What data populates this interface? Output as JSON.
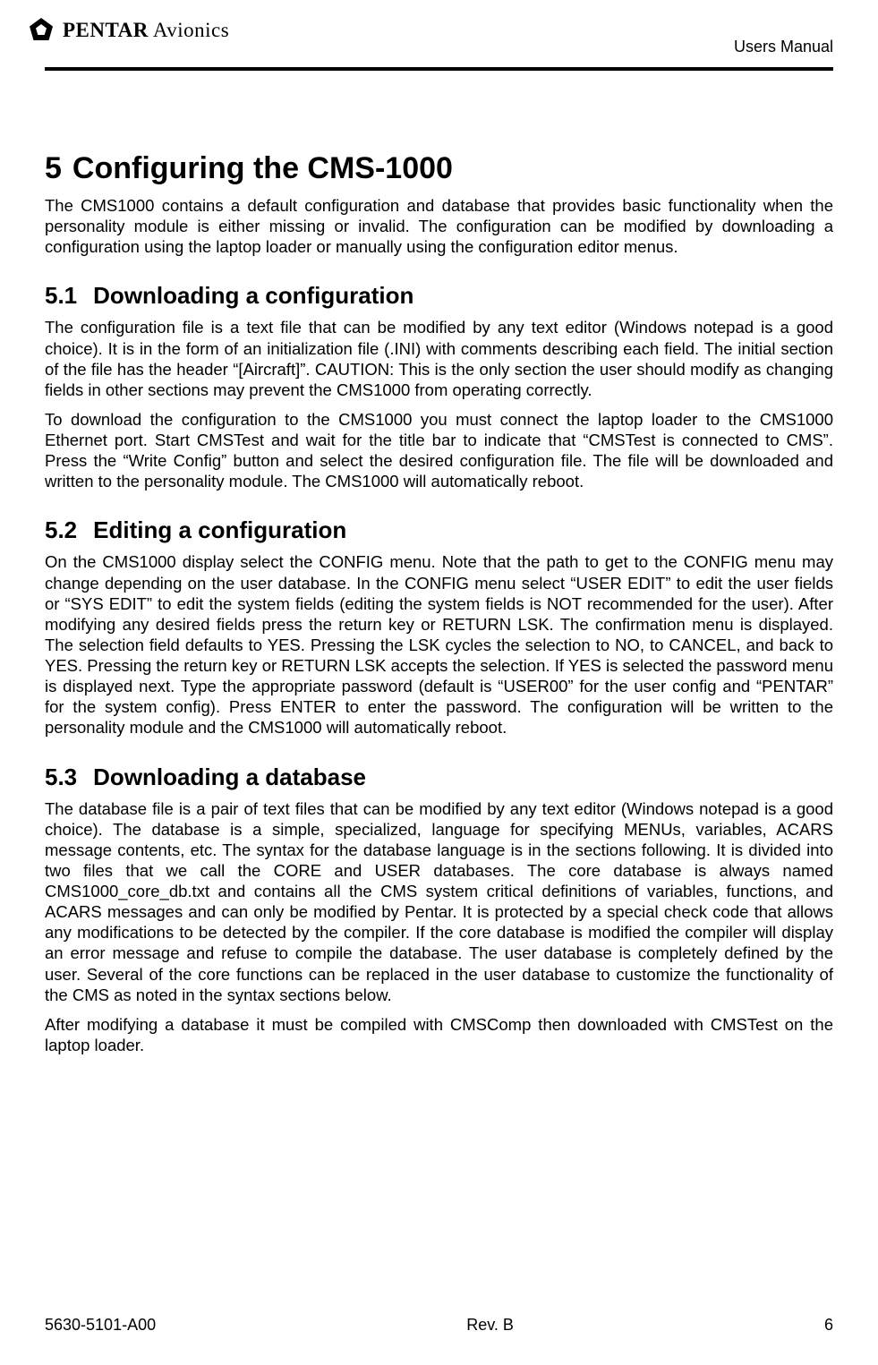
{
  "header": {
    "brand_bold": "PENTAR",
    "brand_light": " Avionics",
    "manual_label": "Users Manual"
  },
  "content": {
    "h1_num": "5",
    "h1_title": "Configuring the CMS-1000",
    "p_intro": "The CMS1000 contains a default configuration and database that provides basic functionality when the personality module is either missing or invalid.  The configuration can be modified by downloading a configuration using the laptop loader or manually using the configuration editor menus.",
    "s51_num": "5.1",
    "s51_title": "Downloading a configuration",
    "s51_p1": "The configuration file is a text file that can be modified by any text editor (Windows notepad is a good choice).  It is in the form of an initialization file (.INI) with comments describing each field.  The initial section of the file has the header “[Aircraft]”.  CAUTION: This is the only section the user should modify as changing fields in other sections may prevent the CMS1000 from operating correctly.",
    "s51_p2": "To download the configuration to the CMS1000 you must connect the laptop loader to the CMS1000 Ethernet port.  Start CMSTest and wait for the title bar to indicate that “CMSTest is connected to CMS”.  Press the “Write Config” button and select the desired configuration file.  The file will be downloaded and written to the personality module.  The CMS1000 will automatically reboot.",
    "s52_num": "5.2",
    "s52_title": "Editing a configuration",
    "s52_p1": "On the CMS1000 display select the CONFIG menu.  Note that the path to get to the CONFIG menu may change depending on the user database.  In the CONFIG menu select “USER EDIT” to edit the user fields or “SYS EDIT” to edit the system fields (editing the system fields is NOT recommended for the user).  After modifying any desired fields press the return key or RETURN LSK.  The confirmation menu is displayed.  The selection field defaults to YES.  Pressing the LSK cycles the selection to NO, to CANCEL, and back to YES.  Pressing the return key or RETURN LSK accepts the selection.  If YES is selected the password menu is displayed next.  Type the appropriate password (default is “USER00” for the user config and “PENTAR” for the system config).  Press ENTER to enter the password.  The configuration will be written to the personality module and the CMS1000 will automatically reboot.",
    "s53_num": "5.3",
    "s53_title": "Downloading a database",
    "s53_p1": "The database file is a pair of text files that can be modified by any text editor (Windows notepad is a good choice).  The database is a simple, specialized, language for specifying MENUs, variables, ACARS message contents, etc.  The syntax for the database language is in the sections following.  It is divided into two files that we call the CORE and USER databases.  The core database is always named CMS1000_core_db.txt and contains all the CMS system critical definitions of variables, functions, and ACARS messages and can only be modified by Pentar.  It is protected by a special check code that allows any modifications to be detected by the compiler.  If the core database is modified the compiler will display an error message and refuse to compile the database.  The user database is completely defined by the user.  Several of the core functions can be replaced in the user database to customize the functionality of the CMS as noted in the syntax sections below.",
    "s53_p2": "After modifying a database it must be compiled with CMSComp then downloaded with CMSTest on the laptop loader."
  },
  "footer": {
    "left": "5630-5101-A00",
    "center": "Rev. B",
    "right": "6"
  }
}
